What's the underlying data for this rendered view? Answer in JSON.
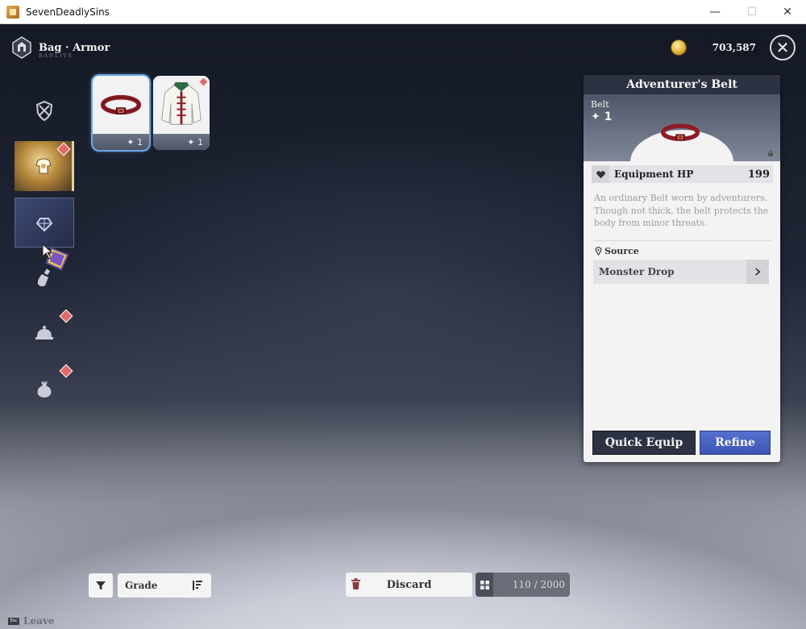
{
  "window": {
    "title": "SevenDeadlySins",
    "min_glyph": "—",
    "max_glyph": "☐",
    "close_glyph": "✕"
  },
  "header": {
    "breadcrumb": "Bag · Armor",
    "breadcrumb_sub": "RANLIVE",
    "gold_amount": "703,587",
    "close_glyph": "✕"
  },
  "sidebar": {
    "categories": [
      {
        "name": "weapon-category",
        "icon": "shield-swords-icon",
        "state": "normal",
        "badge": false
      },
      {
        "name": "armor-category",
        "icon": "armor-icon",
        "state": "gold-active",
        "badge": true
      },
      {
        "name": "accessory-category",
        "icon": "gem-icon",
        "state": "blue-active",
        "badge": false
      },
      {
        "name": "potion-category",
        "icon": "potion-icon",
        "state": "normal",
        "badge": false
      },
      {
        "name": "food-category",
        "icon": "cloche-icon",
        "state": "normal",
        "badge": true
      },
      {
        "name": "materials-category",
        "icon": "sack-icon",
        "state": "normal",
        "badge": true
      }
    ]
  },
  "items": [
    {
      "name": "adventurers-belt",
      "enhance": "1",
      "selected": true,
      "badge": false
    },
    {
      "name": "adventurers-coat",
      "enhance": "1",
      "selected": false,
      "badge": true
    }
  ],
  "detail": {
    "item_name": "Adventurer's Belt",
    "item_type": "Belt",
    "enhance_level": "1",
    "stat_label": "Equipment HP",
    "stat_value": "199",
    "description": "An ordinary Belt worn by adventurers. Though not thick, the belt protects the body from minor threats.",
    "source_label": "Source",
    "source_value": "Monster Drop",
    "quick_equip_label": "Quick Equip",
    "refine_label": "Refine"
  },
  "bottom": {
    "grade_label": "Grade",
    "discard_label": "Discard",
    "capacity": "110 / 2000",
    "esc_key": "Esc",
    "leave_label": "Leave"
  },
  "colors": {
    "panel_header": "#2c3242",
    "refine_button": "#4a62c2",
    "badge": "#e06a6a",
    "selection_glow": "#69a7e6"
  }
}
